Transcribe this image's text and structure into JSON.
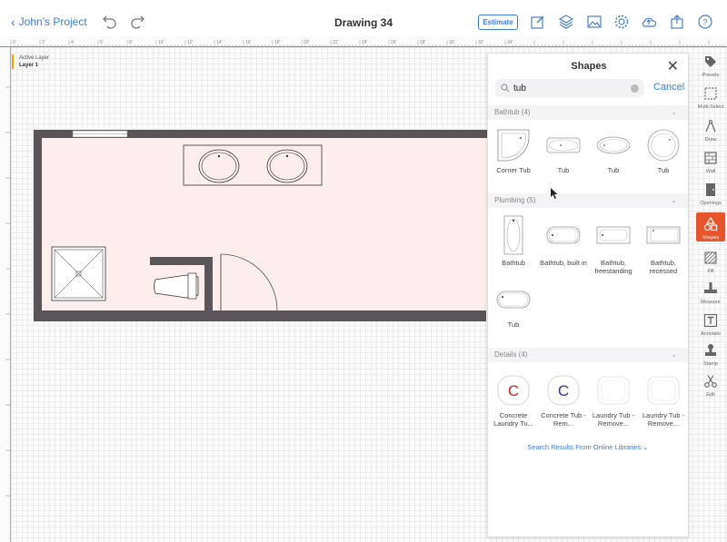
{
  "header": {
    "back_label": "John's Project",
    "title": "Drawing 34",
    "estimate_label": "Estimate",
    "toolbar_icons": [
      "undo-icon",
      "redo-icon",
      "edit-icon",
      "layers-icon",
      "image-icon",
      "settings-icon",
      "upload-icon",
      "share-icon",
      "help-icon"
    ]
  },
  "ruler": {
    "labels": [
      "0'",
      "2'",
      "4'",
      "6'",
      "8'",
      "10'",
      "12'",
      "14'",
      "16'",
      "18'",
      "20'",
      "22'",
      "24'",
      "26'",
      "28'",
      "30'",
      "32'",
      "34'"
    ]
  },
  "active_layer": {
    "caption": "Active Layer",
    "name": "Layer 1"
  },
  "panel": {
    "title": "Shapes",
    "search_value": "tub",
    "cancel_label": "Cancel",
    "sections": [
      {
        "header": "Bathtub (4)",
        "items": [
          "Corner Tub",
          "Tub",
          "Tub",
          "Tub"
        ]
      },
      {
        "header": "Plumbing (5)",
        "items": [
          "Bathtub",
          "Bathtub, built in",
          "Bathtub, freestanding",
          "Bathtub, recessed",
          "Tub"
        ]
      },
      {
        "header": "Details (4)",
        "items": [
          "Concrete Laundry Tu...",
          "Concrete Tub - Rem...",
          "Laundry Tub - Remove...",
          "Laundry Tub - Remove..."
        ],
        "letters": [
          "C",
          "C"
        ]
      }
    ],
    "online_link": "Search Results From Online Libraries"
  },
  "right_toolbar": [
    {
      "label": "Presets",
      "icon": "tag-icon"
    },
    {
      "label": "Multi-Select",
      "icon": "select-icon"
    },
    {
      "label": "Draw",
      "icon": "compass-icon"
    },
    {
      "label": "Wall",
      "icon": "wall-icon"
    },
    {
      "label": "Openings",
      "icon": "door-icon"
    },
    {
      "label": "Shapes",
      "icon": "shapes-icon",
      "active": true
    },
    {
      "label": "Fill",
      "icon": "fill-icon"
    },
    {
      "label": "Measure",
      "icon": "measure-icon"
    },
    {
      "label": "Annotate",
      "icon": "text-icon"
    },
    {
      "label": "Stamp",
      "icon": "stamp-icon"
    },
    {
      "label": "Edit",
      "icon": "scissors-icon"
    }
  ],
  "colors": {
    "accent": "#3a7bd5",
    "active_tool": "#e8542b",
    "wall": "#5a5558",
    "room_fill": "#fdeeee"
  }
}
